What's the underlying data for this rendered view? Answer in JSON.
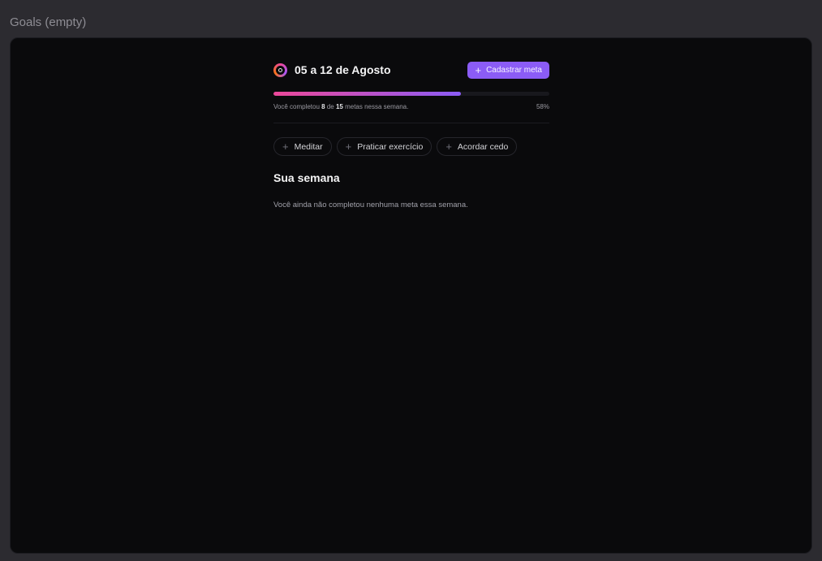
{
  "frame": {
    "label": "Goals (empty)"
  },
  "header": {
    "title": "05 a 12 de Agosto",
    "add_button_label": "Cadastrar meta"
  },
  "progress": {
    "text_before": "Você completou ",
    "completed": "8",
    "text_middle": " de ",
    "total": "15",
    "text_after": " metas nessa semana.",
    "percent_label": "58%",
    "fraction": 0.68
  },
  "pending_goals": [
    {
      "label": "Meditar"
    },
    {
      "label": "Praticar exercício"
    },
    {
      "label": "Acordar cedo"
    }
  ],
  "week": {
    "title": "Sua semana",
    "empty_message": "Você ainda não completou nenhuma meta essa semana."
  },
  "colors": {
    "accent": "#8b5cf6",
    "progress_start": "#ec4899",
    "progress_end": "#8b5cf6",
    "background": "#0a0a0c"
  },
  "icons": {
    "logo": "inorbit-logo-icon",
    "add": "plus-icon"
  }
}
